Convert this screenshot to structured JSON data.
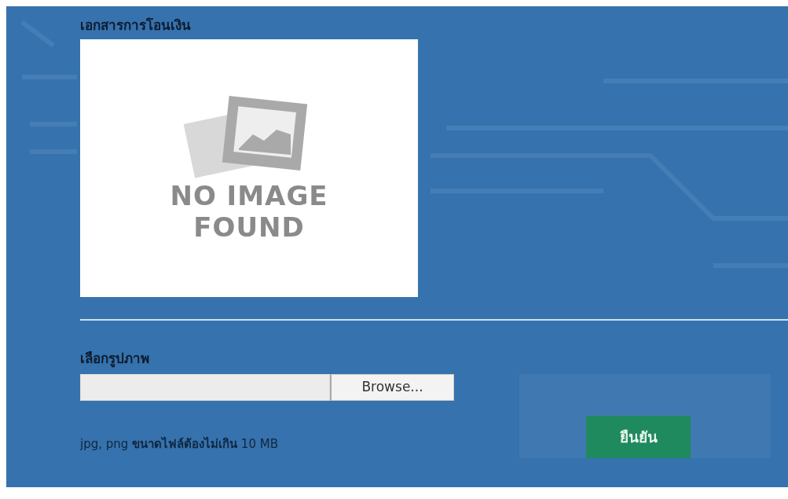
{
  "document_title": "เอกสารการโอนเงิน",
  "preview": {
    "placeholder_text": [
      "NO IMAGE",
      "FOUND"
    ]
  },
  "upload": {
    "label": "เลือกรูปภาพ",
    "browse_button": "Browse...",
    "hint": "jpg, png **ขนาดไฟล์ต้องไม่เกิน** 10 MB"
  },
  "confirm_button": "ยืนยัน"
}
